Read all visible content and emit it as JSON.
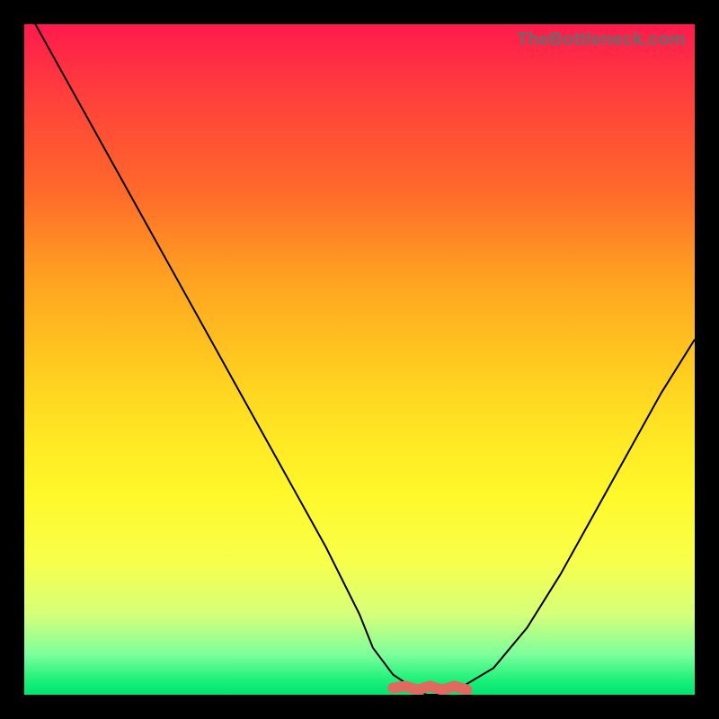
{
  "watermark": "TheBottleneck.com",
  "colors": {
    "page_bg": "#000000",
    "gradient_top": "#ff1a4d",
    "gradient_bottom": "#00e472",
    "curve": "#000000",
    "baseline_band": "#e06a60",
    "watermark_text": "#6a6a6a"
  },
  "chart_data": {
    "type": "line",
    "title": "",
    "xlabel": "",
    "ylabel": "",
    "xlim": [
      0,
      100
    ],
    "ylim": [
      0,
      100
    ],
    "series": [
      {
        "name": "bottleneck-curve",
        "x": [
          0,
          5,
          10,
          15,
          20,
          25,
          30,
          35,
          40,
          45,
          50,
          52,
          55,
          58,
          60,
          62,
          65,
          70,
          75,
          80,
          85,
          90,
          95,
          100
        ],
        "y": [
          103,
          94,
          85,
          76,
          67,
          58,
          49,
          40,
          31,
          22,
          12,
          7,
          3,
          1,
          0,
          0,
          1,
          4,
          10,
          18,
          27,
          36,
          45,
          53
        ]
      }
    ],
    "annotations": [
      {
        "name": "baseline-plateau",
        "x_range": [
          55,
          66
        ],
        "y": 1
      }
    ],
    "grid": false,
    "legend": false
  }
}
